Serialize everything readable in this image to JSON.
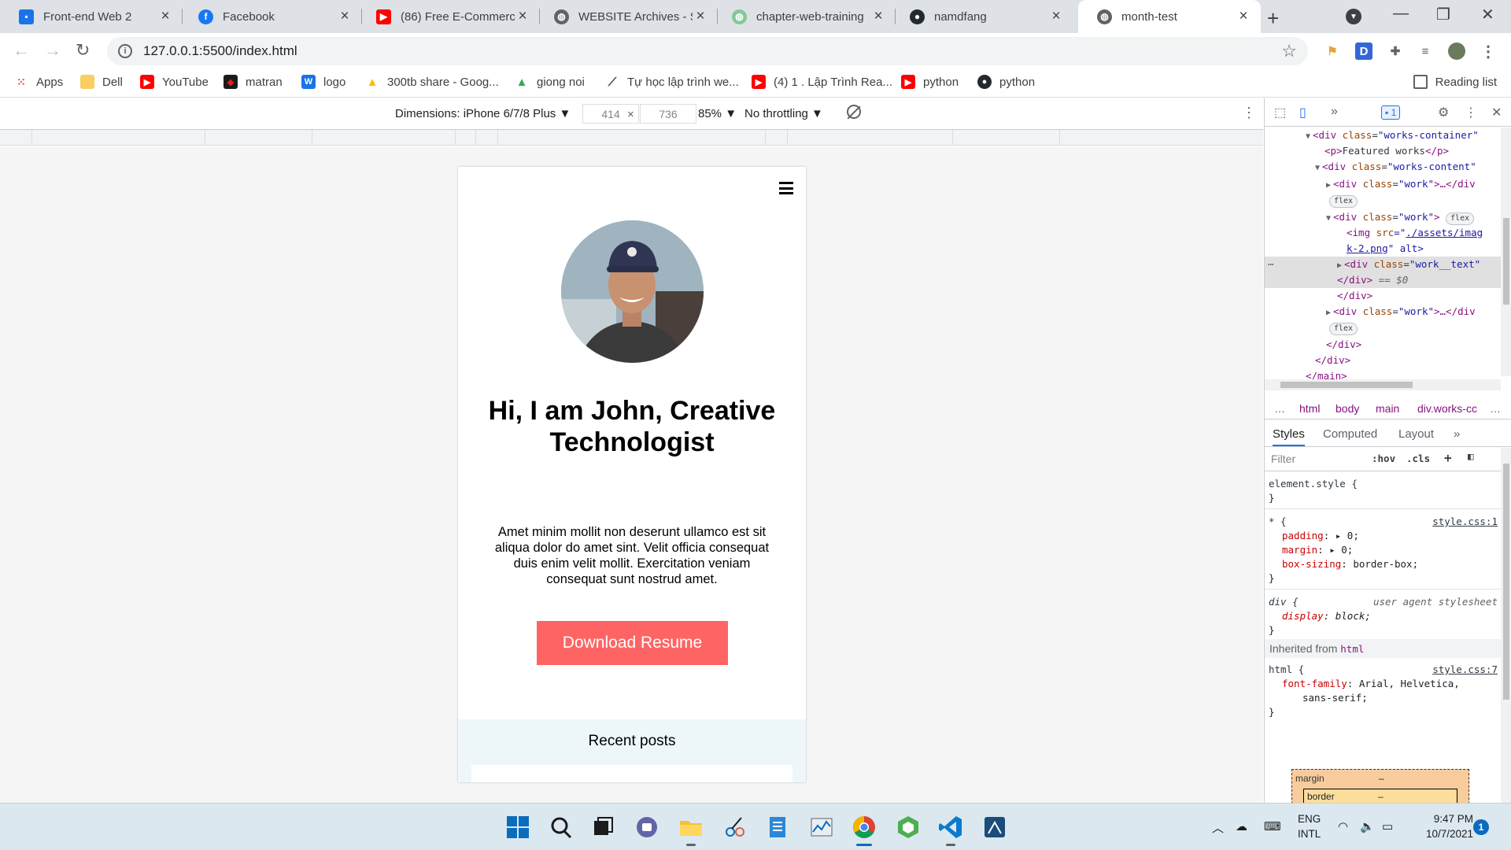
{
  "browser": {
    "tabs": [
      {
        "title": "Front-end Web 2",
        "icon": "user-card-icon"
      },
      {
        "title": "Facebook",
        "icon": "facebook-icon"
      },
      {
        "title": "(86) Free E-Commerce",
        "icon": "youtube-icon"
      },
      {
        "title": "WEBSITE Archives - Sc",
        "icon": "globe-icon"
      },
      {
        "title": "chapter-web-training",
        "icon": "globe-icon"
      },
      {
        "title": "namdfang",
        "icon": "github-icon"
      },
      {
        "title": "month-test",
        "icon": "globe-icon"
      }
    ],
    "url": "127.0.0.1:5500/index.html",
    "profile_letter": "D",
    "bookmarks": [
      {
        "label": "Apps",
        "icon": "apps-grid-icon"
      },
      {
        "label": "Dell",
        "icon": "folder-icon"
      },
      {
        "label": "YouTube",
        "icon": "youtube-icon"
      },
      {
        "label": "matran",
        "icon": "matran-icon"
      },
      {
        "label": "logo",
        "icon": "word-icon"
      },
      {
        "label": "300tb share - Goog...",
        "icon": "drive-icon"
      },
      {
        "label": "giong noi",
        "icon": "drive-icon"
      },
      {
        "label": "Tự học lập trình we...",
        "icon": "link-icon"
      },
      {
        "label": "(4) 1 . Lập Trình Rea...",
        "icon": "youtube-icon"
      },
      {
        "label": "python",
        "icon": "youtube-icon"
      },
      {
        "label": "python",
        "icon": "github-icon"
      }
    ],
    "reading_list": "Reading list"
  },
  "device_toolbar": {
    "dimensions": "Dimensions: iPhone 6/7/8 Plus ▼",
    "width": "414",
    "height": "736",
    "times": "×",
    "zoom": "85% ▼",
    "throttling": "No throttling ▼"
  },
  "site": {
    "hero_title": "Hi, I am John, Creative Technologist",
    "hero_text": "Amet minim mollit non deserunt ullamco est sit aliqua dolor do amet sint. Velit officia consequat duis enim velit mollit. Exercitation veniam consequat sunt nostrud amet.",
    "cta": "Download Resume",
    "recent_posts": "Recent posts",
    "accent_color": "#ff6464",
    "recent_bg": "#edf7fa"
  },
  "devtools": {
    "issues_count": "1",
    "elements": {
      "l1_tag": "<div ",
      "l1_attr": "class",
      "l1_val": "\"works-container\"",
      "l2a": "<p>",
      "l2b": "Featured works",
      "l2c": "</p>",
      "l3_tag": "<div ",
      "l3_attr": "class",
      "l3_val": "\"works-content\"",
      "l4_tag": "<div ",
      "l4_attr": "class",
      "l4_val": "\"work\"",
      "l4_end": ">…</div",
      "flex": "flex",
      "l6_tag": "<div ",
      "l6_attr": "class",
      "l6_val": "\"work\"",
      "l6_end": ">",
      "l7_tag": "<img ",
      "l7_attr": "src",
      "l7_eq": "=\"",
      "l7_link": "./assets/imag",
      "l8_link": "k-2.png",
      "l8_rest": "\" alt>",
      "l9_tag": "<div ",
      "l9_attr": "class",
      "l9_val": "\"work__text\"",
      "l10": "</div>",
      "l10_eq": " == $0",
      "l11": "</div>",
      "l12_tag": "<div ",
      "l12_attr": "class",
      "l12_val": "\"work\"",
      "l12_end": ">…</div",
      "l14": "</div>",
      "l15": "</div>",
      "l16": "</main>"
    },
    "crumbs": [
      "…",
      "html",
      "body",
      "main",
      "div.works-cc",
      "…"
    ],
    "style_tabs": [
      "Styles",
      "Computed",
      "Layout",
      "»"
    ],
    "filter_placeholder": "Filter",
    "hov": ":hov",
    "cls": ".cls",
    "rules": {
      "element_style": "element.style {",
      "close": "}",
      "star_sel": "* {",
      "star_src": "style.css:1",
      "padding": "padding",
      "padding_val": "0;",
      "margin": "margin",
      "margin_val": "0;",
      "boxsizing": "box-sizing",
      "boxsizing_val": "border-box;",
      "div_sel": "div {",
      "ua": "user agent stylesheet",
      "display": "display",
      "display_val": "block;",
      "inherited": "Inherited from",
      "inherited_tag": "html",
      "html_sel": "html {",
      "html_src": "style.css:7",
      "fontfamily": "font-family",
      "fontfamily_val": "Arial, Helvetica,",
      "fontfamily_val2": "sans-serif;",
      "bm_margin": "margin",
      "bm_border": "border",
      "dash": "–"
    }
  },
  "taskbar": {
    "lang1": "ENG",
    "lang2": "INTL",
    "time": "9:47 PM",
    "date": "10/7/2021",
    "notifications": "1"
  }
}
